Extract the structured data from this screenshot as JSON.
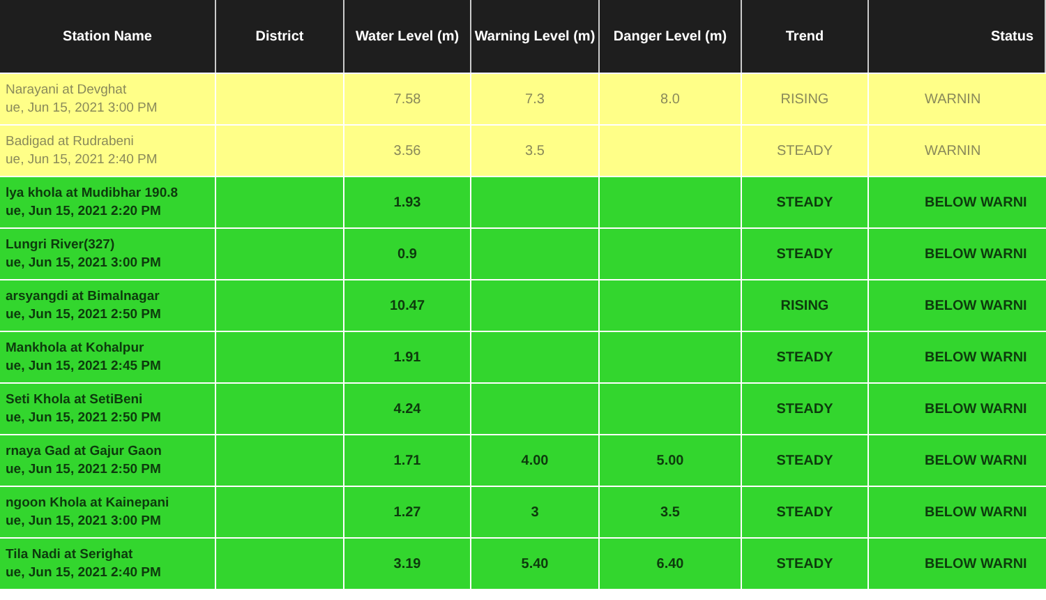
{
  "table": {
    "columns": [
      "Station Name",
      "District",
      "Water Level (m)",
      "Warning Level (m)",
      "Danger Level (m)",
      "Trend",
      "Status"
    ],
    "rows": [
      {
        "kind": "warning",
        "station": "Narayani at Devghat",
        "time": "ue, Jun 15, 2021 3:00 PM",
        "district": "",
        "water": "7.58",
        "warning": "7.3",
        "danger": "8.0",
        "trend": "RISING",
        "status": "WARNIN"
      },
      {
        "kind": "warning",
        "station": "Badigad at Rudrabeni",
        "time": "ue, Jun 15, 2021 2:40 PM",
        "district": "",
        "water": "3.56",
        "warning": "3.5",
        "danger": "",
        "trend": "STEADY",
        "status": "WARNIN"
      },
      {
        "kind": "normal",
        "station": "lya khola at Mudibhar 190.8",
        "time": "ue, Jun 15, 2021 2:20 PM",
        "district": "",
        "water": "1.93",
        "warning": "",
        "danger": "",
        "trend": "STEADY",
        "status": "BELOW WARNI"
      },
      {
        "kind": "normal",
        "station": "Lungri River(327)",
        "time": "ue, Jun 15, 2021 3:00 PM",
        "district": "",
        "water": "0.9",
        "warning": "",
        "danger": "",
        "trend": "STEADY",
        "status": "BELOW WARNI"
      },
      {
        "kind": "normal",
        "station": "arsyangdi at Bimalnagar",
        "time": "ue, Jun 15, 2021 2:50 PM",
        "district": "",
        "water": "10.47",
        "warning": "",
        "danger": "",
        "trend": "RISING",
        "status": "BELOW WARNI"
      },
      {
        "kind": "normal",
        "station": "Mankhola at Kohalpur",
        "time": "ue, Jun 15, 2021 2:45 PM",
        "district": "",
        "water": "1.91",
        "warning": "",
        "danger": "",
        "trend": "STEADY",
        "status": "BELOW WARNI"
      },
      {
        "kind": "normal",
        "station": "Seti Khola at SetiBeni",
        "time": "ue, Jun 15, 2021 2:50 PM",
        "district": "",
        "water": "4.24",
        "warning": "",
        "danger": "",
        "trend": "STEADY",
        "status": "BELOW WARNI"
      },
      {
        "kind": "normal",
        "station": "rnaya Gad at Gajur Gaon",
        "time": "ue, Jun 15, 2021 2:50 PM",
        "district": "",
        "water": "1.71",
        "warning": "4.00",
        "danger": "5.00",
        "trend": "STEADY",
        "status": "BELOW WARNI"
      },
      {
        "kind": "normal",
        "station": "ngoon Khola at Kainepani",
        "time": "ue, Jun 15, 2021 3:00 PM",
        "district": "",
        "water": "1.27",
        "warning": "3",
        "danger": "3.5",
        "trend": "STEADY",
        "status": "BELOW WARNI"
      },
      {
        "kind": "normal",
        "station": "Tila Nadi at Serighat",
        "time": "ue, Jun 15, 2021 2:40 PM",
        "district": "",
        "water": "3.19",
        "warning": "5.40",
        "danger": "6.40",
        "trend": "STEADY",
        "status": "BELOW WARNI"
      }
    ]
  }
}
